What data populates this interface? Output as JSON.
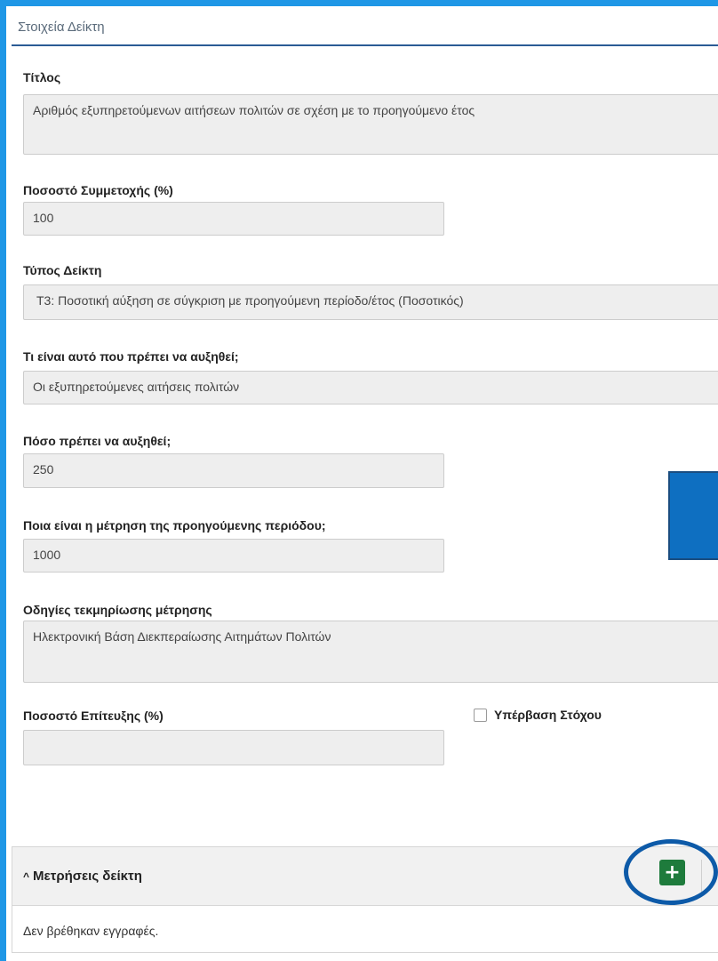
{
  "section_title": "Στοιχεία Δείκτη",
  "fields": {
    "title": {
      "label": "Τίτλος",
      "value": "Αριθμός εξυπηρετούμενων αιτήσεων πολιτών σε σχέση με το προηγούμενο έτος"
    },
    "participation": {
      "label": "Ποσοστό Συμμετοχής (%)",
      "value": "100"
    },
    "indicator_type": {
      "label": "Τύπος Δείκτη",
      "value": "Τ3: Ποσοτική αύξηση σε σύγκριση με προηγούμενη περίοδο/έτος (Ποσοτικός)"
    },
    "what_increase": {
      "label": "Τι είναι αυτό που πρέπει να αυξηθεί;",
      "value": "Οι εξυπηρετούμενες αιτήσεις πολιτών"
    },
    "how_much": {
      "label": "Πόσο πρέπει να αυξηθεί;",
      "value": "250"
    },
    "previous_measurement": {
      "label": "Ποια είναι η μέτρηση της προηγούμενης περιόδου;",
      "value": "1000"
    },
    "documentation": {
      "label": "Οδηγίες τεκμηρίωσης μέτρησης",
      "value": "Ηλεκτρονική Βάση Διεκπεραίωσης Αιτημάτων Πολιτών"
    },
    "achievement": {
      "label": "Ποσοστό Επίτευξης (%)",
      "value": ""
    }
  },
  "target_exceeded": {
    "label": "Υπέρβαση Στόχου",
    "checked": false
  },
  "measurements_panel": {
    "title": "Μετρήσεις δείκτη",
    "chevron_icon": "chevron-up-icon",
    "add_icon": "plus-icon",
    "empty_text": "Δεν βρέθηκαν εγγραφές."
  },
  "colors": {
    "frame": "#1f97e6",
    "add_button": "#1e7b3c",
    "highlight": "#0d5aa8"
  }
}
